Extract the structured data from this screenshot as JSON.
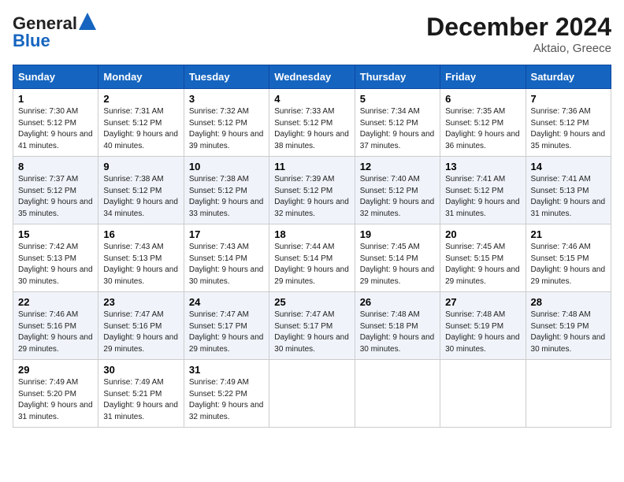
{
  "header": {
    "logo_line1": "General",
    "logo_line2": "Blue",
    "title": "December 2024",
    "subtitle": "Aktaio, Greece"
  },
  "columns": [
    "Sunday",
    "Monday",
    "Tuesday",
    "Wednesday",
    "Thursday",
    "Friday",
    "Saturday"
  ],
  "weeks": [
    [
      {
        "day": 1,
        "sunrise": "7:30 AM",
        "sunset": "5:12 PM",
        "daylight": "9 hours and 41 minutes."
      },
      {
        "day": 2,
        "sunrise": "7:31 AM",
        "sunset": "5:12 PM",
        "daylight": "9 hours and 40 minutes."
      },
      {
        "day": 3,
        "sunrise": "7:32 AM",
        "sunset": "5:12 PM",
        "daylight": "9 hours and 39 minutes."
      },
      {
        "day": 4,
        "sunrise": "7:33 AM",
        "sunset": "5:12 PM",
        "daylight": "9 hours and 38 minutes."
      },
      {
        "day": 5,
        "sunrise": "7:34 AM",
        "sunset": "5:12 PM",
        "daylight": "9 hours and 37 minutes."
      },
      {
        "day": 6,
        "sunrise": "7:35 AM",
        "sunset": "5:12 PM",
        "daylight": "9 hours and 36 minutes."
      },
      {
        "day": 7,
        "sunrise": "7:36 AM",
        "sunset": "5:12 PM",
        "daylight": "9 hours and 35 minutes."
      }
    ],
    [
      {
        "day": 8,
        "sunrise": "7:37 AM",
        "sunset": "5:12 PM",
        "daylight": "9 hours and 35 minutes."
      },
      {
        "day": 9,
        "sunrise": "7:38 AM",
        "sunset": "5:12 PM",
        "daylight": "9 hours and 34 minutes."
      },
      {
        "day": 10,
        "sunrise": "7:38 AM",
        "sunset": "5:12 PM",
        "daylight": "9 hours and 33 minutes."
      },
      {
        "day": 11,
        "sunrise": "7:39 AM",
        "sunset": "5:12 PM",
        "daylight": "9 hours and 32 minutes."
      },
      {
        "day": 12,
        "sunrise": "7:40 AM",
        "sunset": "5:12 PM",
        "daylight": "9 hours and 32 minutes."
      },
      {
        "day": 13,
        "sunrise": "7:41 AM",
        "sunset": "5:12 PM",
        "daylight": "9 hours and 31 minutes."
      },
      {
        "day": 14,
        "sunrise": "7:41 AM",
        "sunset": "5:13 PM",
        "daylight": "9 hours and 31 minutes."
      }
    ],
    [
      {
        "day": 15,
        "sunrise": "7:42 AM",
        "sunset": "5:13 PM",
        "daylight": "9 hours and 30 minutes."
      },
      {
        "day": 16,
        "sunrise": "7:43 AM",
        "sunset": "5:13 PM",
        "daylight": "9 hours and 30 minutes."
      },
      {
        "day": 17,
        "sunrise": "7:43 AM",
        "sunset": "5:14 PM",
        "daylight": "9 hours and 30 minutes."
      },
      {
        "day": 18,
        "sunrise": "7:44 AM",
        "sunset": "5:14 PM",
        "daylight": "9 hours and 29 minutes."
      },
      {
        "day": 19,
        "sunrise": "7:45 AM",
        "sunset": "5:14 PM",
        "daylight": "9 hours and 29 minutes."
      },
      {
        "day": 20,
        "sunrise": "7:45 AM",
        "sunset": "5:15 PM",
        "daylight": "9 hours and 29 minutes."
      },
      {
        "day": 21,
        "sunrise": "7:46 AM",
        "sunset": "5:15 PM",
        "daylight": "9 hours and 29 minutes."
      }
    ],
    [
      {
        "day": 22,
        "sunrise": "7:46 AM",
        "sunset": "5:16 PM",
        "daylight": "9 hours and 29 minutes."
      },
      {
        "day": 23,
        "sunrise": "7:47 AM",
        "sunset": "5:16 PM",
        "daylight": "9 hours and 29 minutes."
      },
      {
        "day": 24,
        "sunrise": "7:47 AM",
        "sunset": "5:17 PM",
        "daylight": "9 hours and 29 minutes."
      },
      {
        "day": 25,
        "sunrise": "7:47 AM",
        "sunset": "5:17 PM",
        "daylight": "9 hours and 30 minutes."
      },
      {
        "day": 26,
        "sunrise": "7:48 AM",
        "sunset": "5:18 PM",
        "daylight": "9 hours and 30 minutes."
      },
      {
        "day": 27,
        "sunrise": "7:48 AM",
        "sunset": "5:19 PM",
        "daylight": "9 hours and 30 minutes."
      },
      {
        "day": 28,
        "sunrise": "7:48 AM",
        "sunset": "5:19 PM",
        "daylight": "9 hours and 30 minutes."
      }
    ],
    [
      {
        "day": 29,
        "sunrise": "7:49 AM",
        "sunset": "5:20 PM",
        "daylight": "9 hours and 31 minutes."
      },
      {
        "day": 30,
        "sunrise": "7:49 AM",
        "sunset": "5:21 PM",
        "daylight": "9 hours and 31 minutes."
      },
      {
        "day": 31,
        "sunrise": "7:49 AM",
        "sunset": "5:22 PM",
        "daylight": "9 hours and 32 minutes."
      },
      null,
      null,
      null,
      null
    ]
  ]
}
